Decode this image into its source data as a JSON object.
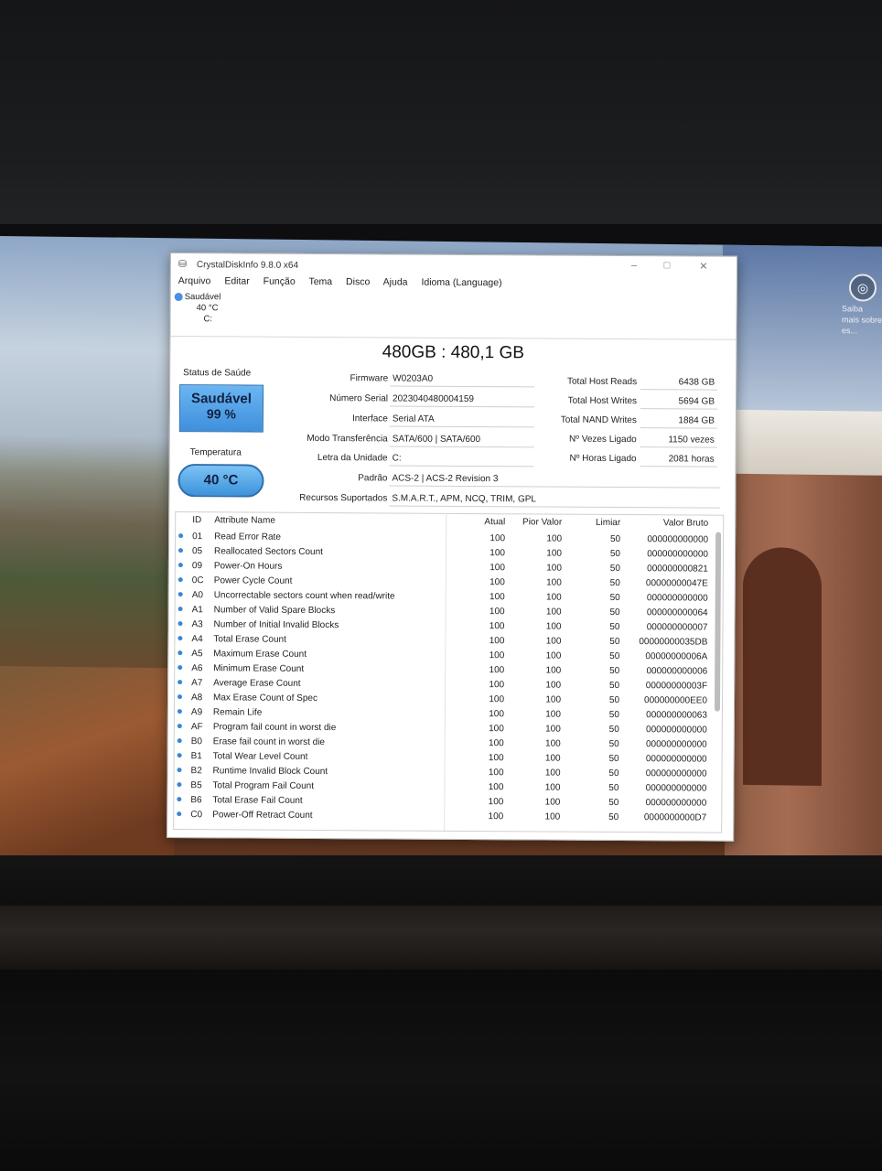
{
  "spotlight": {
    "text": "Saiba mais sobre es..."
  },
  "window": {
    "title": "CrystalDiskInfo 9.8.0 x64",
    "menu": [
      "Arquivo",
      "Editar",
      "Função",
      "Tema",
      "Disco",
      "Ajuda",
      "Idioma (Language)"
    ],
    "disk_tab": {
      "status": "Saudável",
      "temp": "40 °C",
      "letter": "C:"
    }
  },
  "drive": {
    "model": "480GB : 480,1 GB",
    "health_label": "Status de Saúde",
    "health_status": "Saudável",
    "health_pct": "99 %",
    "temp_label": "Temperatura",
    "temp": "40 °C",
    "firmware": {
      "label": "Firmware",
      "value": "W0203A0"
    },
    "serial": {
      "label": "Número Serial",
      "value": "2023040480004159"
    },
    "interface": {
      "label": "Interface",
      "value": "Serial ATA"
    },
    "transfer": {
      "label": "Modo Transferência",
      "value": "SATA/600 | SATA/600"
    },
    "letter": {
      "label": "Letra da Unidade",
      "value": "C:"
    },
    "standard": {
      "label": "Padrão",
      "value": "ACS-2 | ACS-2 Revision 3"
    },
    "features": {
      "label": "Recursos Suportados",
      "value": "S.M.A.R.T., APM, NCQ, TRIM, GPL"
    },
    "host_reads": {
      "label": "Total Host Reads",
      "value": "6438 GB"
    },
    "host_writes": {
      "label": "Total Host Writes",
      "value": "5694 GB"
    },
    "nand_writes": {
      "label": "Total NAND Writes",
      "value": "1884 GB"
    },
    "power_count": {
      "label": "Nº Vezes Ligado",
      "value": "1150 vezes"
    },
    "power_hours": {
      "label": "Nº Horas Ligado",
      "value": "2081 horas"
    }
  },
  "table": {
    "headers": {
      "id": "ID",
      "name": "Attribute Name",
      "current": "Atual",
      "worst": "Pior Valor",
      "threshold": "Limiar",
      "raw": "Valor Bruto"
    },
    "rows": [
      {
        "id": "01",
        "name": "Read Error Rate",
        "cur": "100",
        "worst": "100",
        "thr": "50",
        "raw": "000000000000"
      },
      {
        "id": "05",
        "name": "Reallocated Sectors Count",
        "cur": "100",
        "worst": "100",
        "thr": "50",
        "raw": "000000000000"
      },
      {
        "id": "09",
        "name": "Power-On Hours",
        "cur": "100",
        "worst": "100",
        "thr": "50",
        "raw": "000000000821"
      },
      {
        "id": "0C",
        "name": "Power Cycle Count",
        "cur": "100",
        "worst": "100",
        "thr": "50",
        "raw": "00000000047E"
      },
      {
        "id": "A0",
        "name": "Uncorrectable sectors count when read/write",
        "cur": "100",
        "worst": "100",
        "thr": "50",
        "raw": "000000000000"
      },
      {
        "id": "A1",
        "name": "Number of Valid Spare Blocks",
        "cur": "100",
        "worst": "100",
        "thr": "50",
        "raw": "000000000064"
      },
      {
        "id": "A3",
        "name": "Number of Initial Invalid Blocks",
        "cur": "100",
        "worst": "100",
        "thr": "50",
        "raw": "000000000007"
      },
      {
        "id": "A4",
        "name": "Total Erase Count",
        "cur": "100",
        "worst": "100",
        "thr": "50",
        "raw": "00000000035DB"
      },
      {
        "id": "A5",
        "name": "Maximum Erase Count",
        "cur": "100",
        "worst": "100",
        "thr": "50",
        "raw": "00000000006A"
      },
      {
        "id": "A6",
        "name": "Minimum Erase Count",
        "cur": "100",
        "worst": "100",
        "thr": "50",
        "raw": "000000000006"
      },
      {
        "id": "A7",
        "name": "Average Erase Count",
        "cur": "100",
        "worst": "100",
        "thr": "50",
        "raw": "00000000003F"
      },
      {
        "id": "A8",
        "name": "Max Erase Count of Spec",
        "cur": "100",
        "worst": "100",
        "thr": "50",
        "raw": "000000000EE0"
      },
      {
        "id": "A9",
        "name": "Remain Life",
        "cur": "100",
        "worst": "100",
        "thr": "50",
        "raw": "000000000063"
      },
      {
        "id": "AF",
        "name": "Program fail count in worst die",
        "cur": "100",
        "worst": "100",
        "thr": "50",
        "raw": "000000000000"
      },
      {
        "id": "B0",
        "name": "Erase fail count in worst die",
        "cur": "100",
        "worst": "100",
        "thr": "50",
        "raw": "000000000000"
      },
      {
        "id": "B1",
        "name": "Total Wear Level Count",
        "cur": "100",
        "worst": "100",
        "thr": "50",
        "raw": "000000000000"
      },
      {
        "id": "B2",
        "name": "Runtime Invalid Block Count",
        "cur": "100",
        "worst": "100",
        "thr": "50",
        "raw": "000000000000"
      },
      {
        "id": "B5",
        "name": "Total Program Fail Count",
        "cur": "100",
        "worst": "100",
        "thr": "50",
        "raw": "000000000000"
      },
      {
        "id": "B6",
        "name": "Total Erase Fail Count",
        "cur": "100",
        "worst": "100",
        "thr": "50",
        "raw": "000000000000"
      },
      {
        "id": "C0",
        "name": "Power-Off Retract Count",
        "cur": "100",
        "worst": "100",
        "thr": "50",
        "raw": "0000000000D7"
      }
    ]
  }
}
